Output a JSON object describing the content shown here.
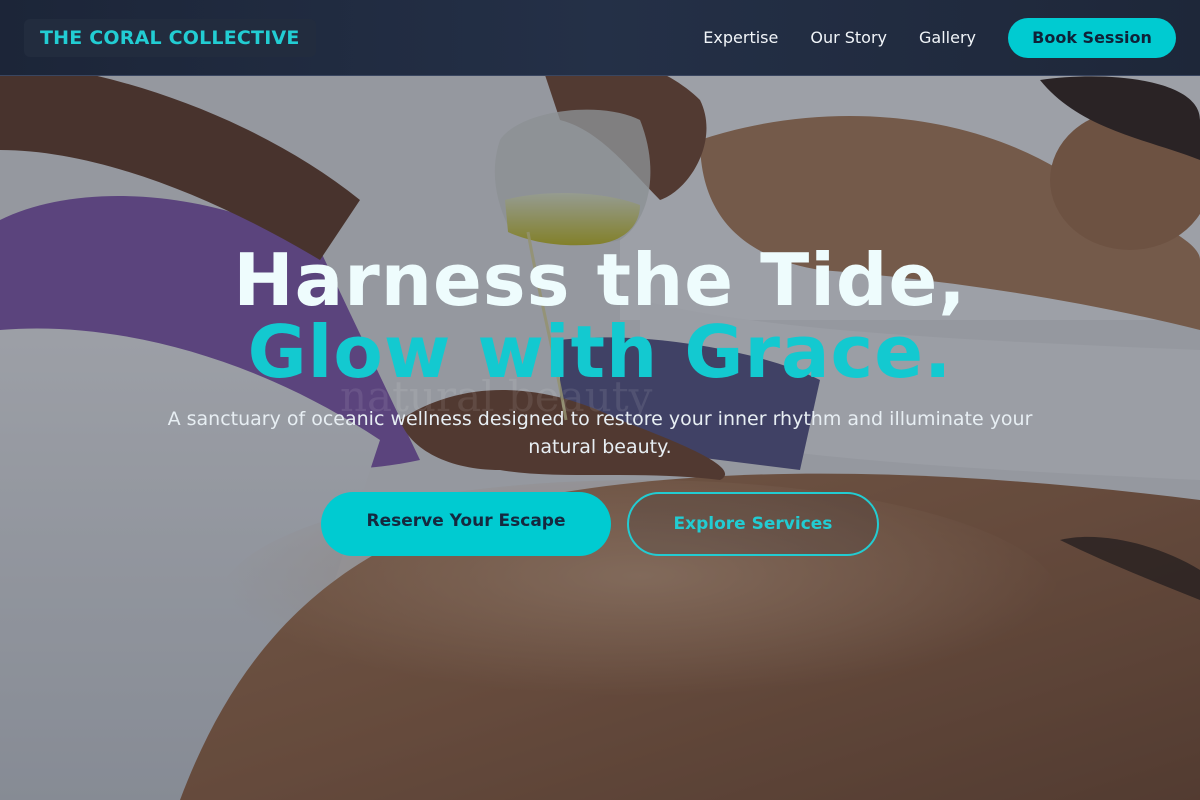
{
  "brand": {
    "name": "THE CORAL COLLECTIVE"
  },
  "nav": {
    "links": [
      "Expertise",
      "Our Story",
      "Gallery"
    ],
    "book_label": "Book Session"
  },
  "hero": {
    "headline_line1": "Harness the Tide,",
    "headline_line2": "Glow with Grace.",
    "watermark": "natural beauty",
    "subtitle": "A sanctuary of oceanic wellness designed to restore your inner rhythm and illuminate your natural beauty.",
    "primary_cta": "Reserve Your Escape",
    "secondary_cta": "Explore Services"
  },
  "colors": {
    "accent": "#00cbd1",
    "nav_bg": "#1f2a3d",
    "headline_light": "#eefcfd",
    "headline_accent": "#13c9d0"
  }
}
